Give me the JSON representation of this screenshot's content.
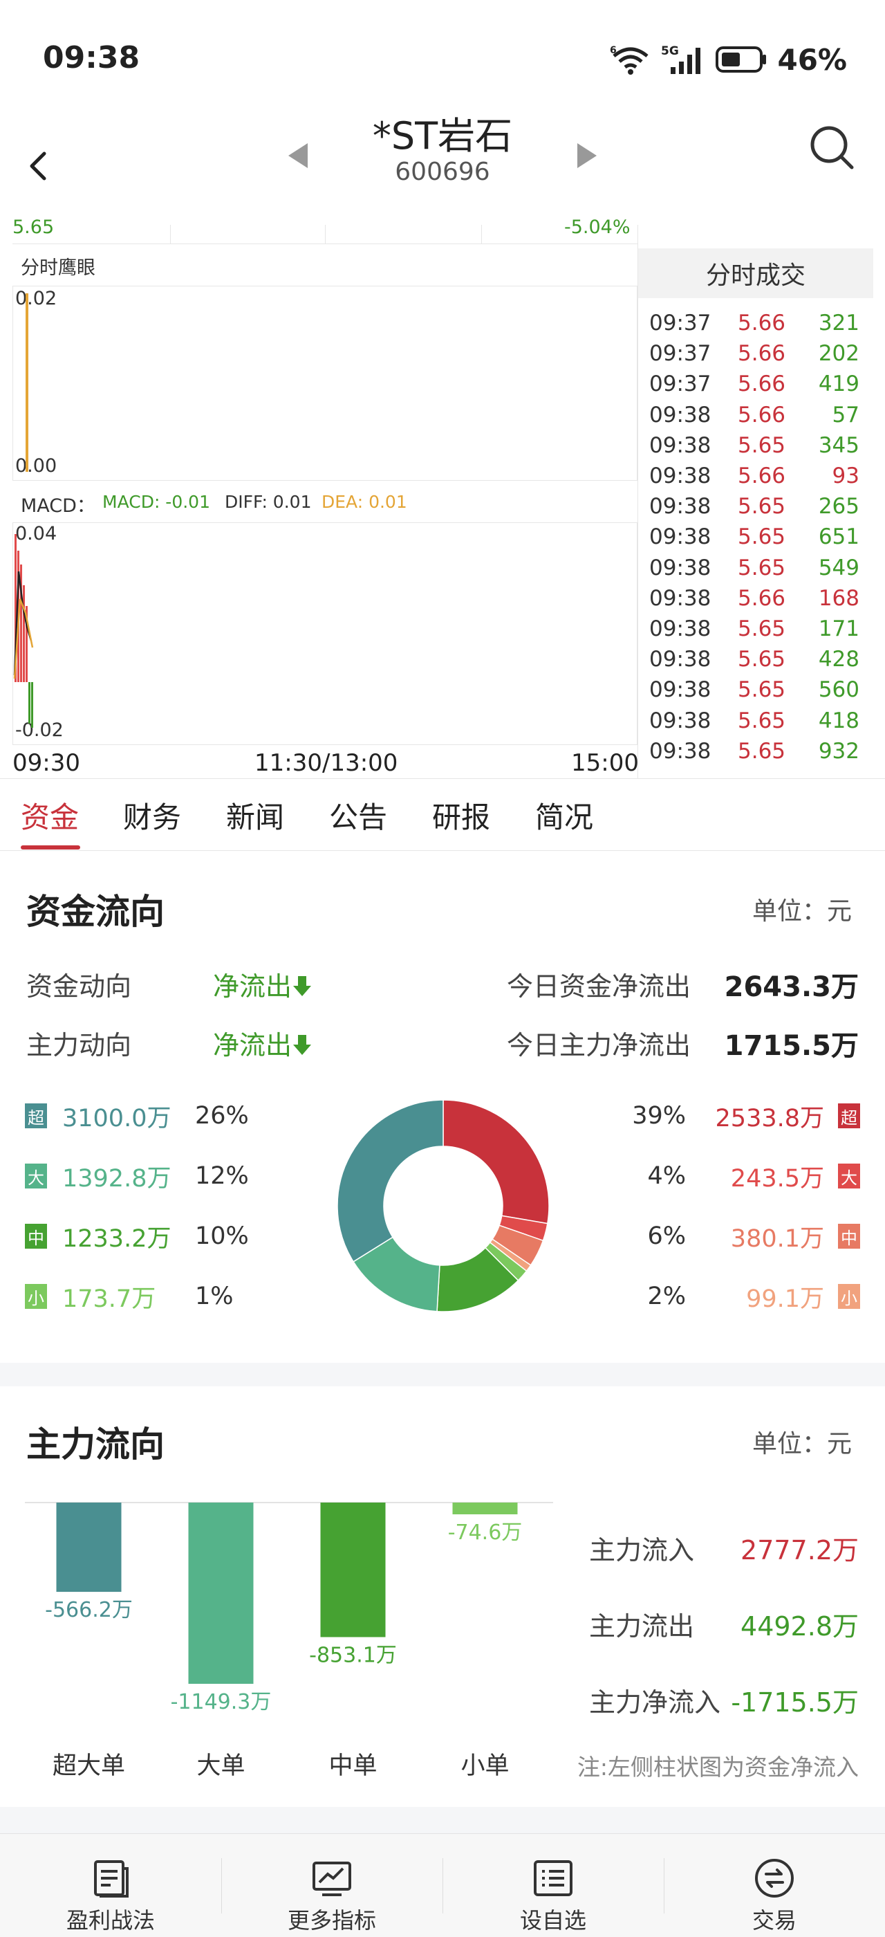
{
  "status": {
    "time": "09:38",
    "battery": "46%",
    "network": "5G",
    "wifi_badge": "6"
  },
  "header": {
    "name": "*ST岩石",
    "code": "600696"
  },
  "chart": {
    "top_fragment_left": "5.65",
    "top_fragment_right": "-5.04%",
    "eagle_title": "分时鹰眼",
    "eagle_top": "0.02",
    "eagle_bottom": "0.00",
    "macd_title": "MACD：",
    "macd_label": "MACD: -0.01",
    "diff_label": "DIFF: 0.01",
    "dea_label": "DEA: 0.01",
    "macd_top": "0.04",
    "macd_bottom": "-0.02",
    "time_start": "09:30",
    "time_mid": "11:30/13:00",
    "time_end": "15:00"
  },
  "ticks": {
    "title": "分时成交",
    "rows": [
      {
        "time": "09:37",
        "price": "5.66",
        "vol": "321",
        "dir": "green"
      },
      {
        "time": "09:37",
        "price": "5.66",
        "vol": "202",
        "dir": "green"
      },
      {
        "time": "09:37",
        "price": "5.66",
        "vol": "419",
        "dir": "green"
      },
      {
        "time": "09:38",
        "price": "5.66",
        "vol": "57",
        "dir": "green"
      },
      {
        "time": "09:38",
        "price": "5.65",
        "vol": "345",
        "dir": "green"
      },
      {
        "time": "09:38",
        "price": "5.66",
        "vol": "93",
        "dir": "red"
      },
      {
        "time": "09:38",
        "price": "5.65",
        "vol": "265",
        "dir": "green"
      },
      {
        "time": "09:38",
        "price": "5.65",
        "vol": "651",
        "dir": "green"
      },
      {
        "time": "09:38",
        "price": "5.65",
        "vol": "549",
        "dir": "green"
      },
      {
        "time": "09:38",
        "price": "5.66",
        "vol": "168",
        "dir": "red"
      },
      {
        "time": "09:38",
        "price": "5.65",
        "vol": "171",
        "dir": "green"
      },
      {
        "time": "09:38",
        "price": "5.65",
        "vol": "428",
        "dir": "green"
      },
      {
        "time": "09:38",
        "price": "5.65",
        "vol": "560",
        "dir": "green"
      },
      {
        "time": "09:38",
        "price": "5.65",
        "vol": "418",
        "dir": "green"
      },
      {
        "time": "09:38",
        "price": "5.65",
        "vol": "932",
        "dir": "green"
      }
    ]
  },
  "tabs": [
    "资金",
    "财务",
    "新闻",
    "公告",
    "研报",
    "简况"
  ],
  "fund_flow": {
    "title": "资金流向",
    "unit": "单位：元",
    "direction_label": "资金动向",
    "direction_value": "净流出",
    "main_label": "主力动向",
    "main_value": "净流出",
    "net_out_label": "今日资金净流出",
    "net_out_value": "2643.3万",
    "main_out_label": "今日主力净流出",
    "main_out_value": "1715.5万",
    "outflow": [
      {
        "badge": "超",
        "amount": "3100.0万",
        "pct": "26%",
        "color": "#4a8f91"
      },
      {
        "badge": "大",
        "amount": "1392.8万",
        "pct": "12%",
        "color": "#55b38a"
      },
      {
        "badge": "中",
        "amount": "1233.2万",
        "pct": "10%",
        "color": "#46a232"
      },
      {
        "badge": "小",
        "amount": "173.7万",
        "pct": "1%",
        "color": "#7cc95e"
      }
    ],
    "inflow": [
      {
        "badge": "超",
        "amount": "2533.8万",
        "pct": "39%",
        "color": "#c8323b"
      },
      {
        "badge": "大",
        "amount": "243.5万",
        "pct": "4%",
        "color": "#e04b4b"
      },
      {
        "badge": "中",
        "amount": "380.1万",
        "pct": "6%",
        "color": "#e77a63"
      },
      {
        "badge": "小",
        "amount": "99.1万",
        "pct": "2%",
        "color": "#f1a27e"
      }
    ]
  },
  "main_flow": {
    "title": "主力流向",
    "unit": "单位：元",
    "inflow_label": "主力流入",
    "inflow_value": "2777.2万",
    "outflow_label": "主力流出",
    "outflow_value": "4492.8万",
    "net_label": "主力净流入",
    "net_value": "-1715.5万",
    "note": "注:左侧柱状图为资金净流入",
    "bars": [
      {
        "label": "超大单",
        "value": -566.2,
        "text": "-566.2万",
        "color": "#4a8f91"
      },
      {
        "label": "大单",
        "value": -1149.3,
        "text": "-1149.3万",
        "color": "#55b38a"
      },
      {
        "label": "中单",
        "value": -853.1,
        "text": "-853.1万",
        "color": "#46a232"
      },
      {
        "label": "小单",
        "value": -74.6,
        "text": "-74.6万",
        "color": "#7cc95e"
      }
    ]
  },
  "nav": [
    "盈利战法",
    "更多指标",
    "设自选",
    "交易"
  ]
}
